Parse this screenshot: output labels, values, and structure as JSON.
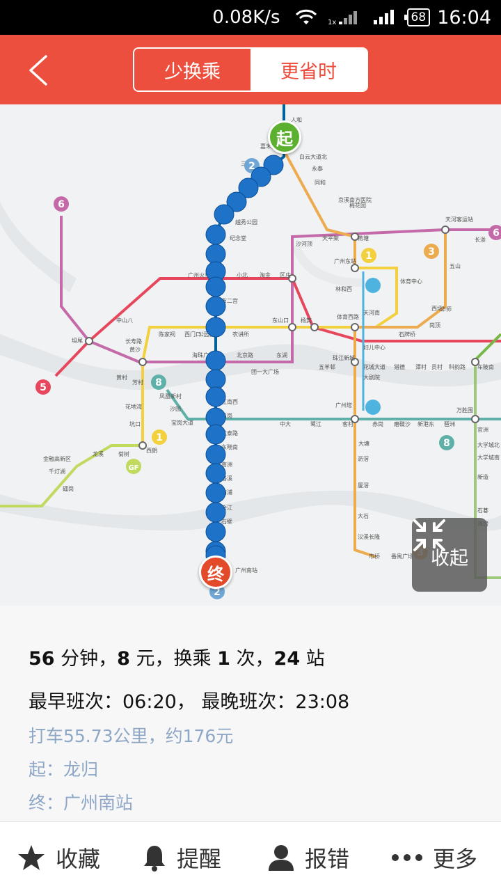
{
  "status_bar": {
    "speed": "0.08K/s",
    "battery": "68",
    "time": "16:04"
  },
  "header": {
    "tabs": [
      {
        "label": "少换乘",
        "active": true
      },
      {
        "label": "更省时",
        "active": false
      }
    ]
  },
  "map": {
    "start_pin": "起",
    "end_pin": "终",
    "collapse_label": "收起",
    "line_badges": [
      "6",
      "2",
      "1",
      "3",
      "6",
      "5",
      "8",
      "1",
      "GF",
      "8",
      "3",
      "2"
    ],
    "stations": [
      "广州火车站",
      "小北",
      "淘金",
      "区庄",
      "林和西",
      "燕塘",
      "天平架",
      "沙河顶",
      "体育中心",
      "天河南",
      "体育西路",
      "杨箕",
      "东山口",
      "农讲所",
      "公园前",
      "西门口",
      "陈家祠",
      "长寿路",
      "中山八",
      "坦尾",
      "黄沙",
      "海珠广场",
      "北京路",
      "团一大广场",
      "东湖",
      "五羊邨",
      "珠江新城",
      "猎德",
      "潭村",
      "员村",
      "科韵路",
      "车陂南",
      "广州塔",
      "客村",
      "赤岗",
      "磨碟沙",
      "新港东",
      "琶洲",
      "万胜围",
      "中大",
      "鹭江",
      "宝岗大道",
      "凤凰新村",
      "沙园",
      "花地湾",
      "芳村",
      "坑口",
      "西朗",
      "龙溪",
      "菊树",
      "金融高新区",
      "千灯湖",
      "礌岗",
      "大塘",
      "沥滘",
      "厦滘",
      "大石",
      "汉溪长隆",
      "市桥",
      "番禺广场",
      "西场",
      "梅花园",
      "永泰",
      "同和",
      "京溪南方医院",
      "白云大道北",
      "嘉禾望岗",
      "人和",
      "天河客运站",
      "长湴",
      "五山",
      "华师",
      "岗顶",
      "石牌桥",
      "广州东站",
      "大剧院",
      "花城大道",
      "妇儿中心",
      "黄村",
      "官洲",
      "大学城北",
      "大学城南",
      "新造",
      "石碁",
      "海傍",
      "三元里",
      "越秀公园",
      "纪念堂",
      "市二宫",
      "江南西",
      "昌岗",
      "江泰路",
      "东晓南",
      "南洲",
      "洛溪",
      "南浦",
      "会江",
      "石壁",
      "广州南站"
    ]
  },
  "info": {
    "summary": {
      "minutes": "56",
      "minutes_unit": " 分钟，",
      "fare": "8",
      "fare_unit": " 元，换乘 ",
      "transfers": "1",
      "transfers_unit": " 次，",
      "stops": "24",
      "stops_unit": " 站"
    },
    "schedule": "最早班次：06:20， 最晚班次：23:08",
    "taxi": "打车55.73公里，约176元",
    "from": "起：龙归",
    "to": "终：广州南站"
  },
  "bottom_bar": {
    "items": [
      {
        "label": "收藏",
        "icon": "star-icon"
      },
      {
        "label": "提醒",
        "icon": "bell-icon"
      },
      {
        "label": "报错",
        "icon": "user-icon"
      },
      {
        "label": "更多",
        "icon": "more-dots-icon"
      }
    ]
  },
  "colors": {
    "brand": "#ec4f3e",
    "line_1": "#f3d03e",
    "line_2": "#00629b",
    "line_3": "#ecab4f",
    "line_5": "#e6475c",
    "line_6": "#c46aa9",
    "line_8": "#5eb0a8",
    "line_gf": "#c0d95f",
    "line_apm": "#4fb3e0",
    "route_dot": "#1e72c8",
    "info_secondary": "#8fa7c7"
  }
}
